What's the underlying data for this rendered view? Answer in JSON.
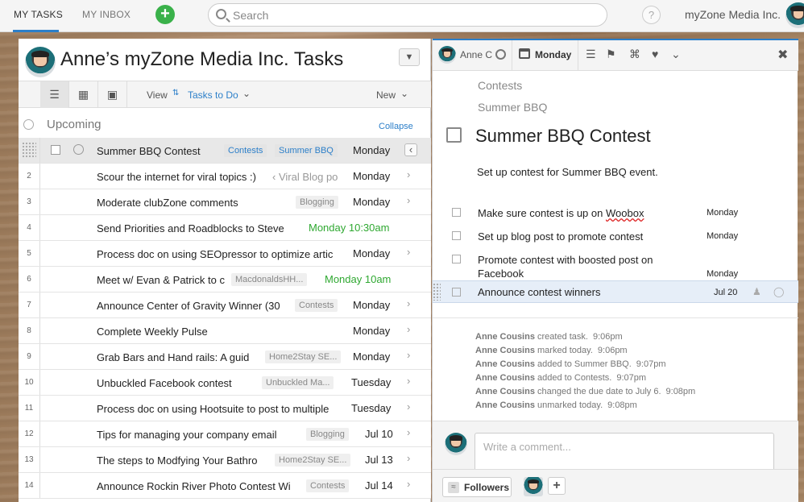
{
  "topbar": {
    "tab_my_tasks": "MY TASKS",
    "tab_my_inbox": "MY INBOX",
    "search_placeholder": "Search",
    "help": "?",
    "org_name": "myZone Media Inc."
  },
  "left": {
    "title": "Anne’s myZone Media Inc. Tasks",
    "view_label": "View",
    "view_value": "Tasks to Do",
    "new_label": "New",
    "section": "Upcoming",
    "collapse": "Collapse",
    "rows": [
      {
        "num": "",
        "name": "Summer BBQ Contest",
        "tags": [
          "Contests",
          "Summer BBQ"
        ],
        "due": "Monday",
        "selected": true
      },
      {
        "num": "2",
        "name": "Scour the internet for viral topics :)",
        "link": "‹ Viral Blog po",
        "due": "Monday"
      },
      {
        "num": "3",
        "name": "Moderate clubZone comments",
        "tags": [
          "Blogging"
        ],
        "due": "Monday"
      },
      {
        "num": "4",
        "name": "Send Priorities and Roadblocks to Steve",
        "due": "Monday 10:30am",
        "green": true
      },
      {
        "num": "5",
        "name": "Process doc on using SEOpressor to optimize artic",
        "due": "Monday"
      },
      {
        "num": "6",
        "name": "Meet w/ Evan & Patrick to c",
        "tags": [
          "MacdonaldsHH..."
        ],
        "due": "Monday 10am",
        "green": true
      },
      {
        "num": "7",
        "name": "Announce Center of Gravity Winner (30",
        "tags": [
          "Contests"
        ],
        "due": "Monday"
      },
      {
        "num": "8",
        "name": "Complete Weekly Pulse",
        "due": "Monday"
      },
      {
        "num": "9",
        "name": "Grab Bars and Hand rails: A guid",
        "tags": [
          "Home2Stay SE..."
        ],
        "due": "Monday"
      },
      {
        "num": "10",
        "name": "Unbuckled Facebook contest",
        "tags": [
          "Unbuckled Ma..."
        ],
        "due": "Tuesday"
      },
      {
        "num": "11",
        "name": "Process doc on using Hootsuite to post to multiple",
        "due": "Tuesday"
      },
      {
        "num": "12",
        "name": "Tips for managing your company email",
        "tags": [
          "Blogging"
        ],
        "due": "Jul 10"
      },
      {
        "num": "13",
        "name": "The steps to Modfying Your Bathro",
        "tags": [
          "Home2Stay SE..."
        ],
        "due": "Jul 13"
      },
      {
        "num": "14",
        "name": "Announce Rockin River Photo Contest Wi",
        "tags": [
          "Contests"
        ],
        "due": "Jul 14"
      }
    ]
  },
  "right": {
    "assignee": "Anne C",
    "due_date": "Monday",
    "breadcrumbs": [
      "Contests",
      "Summer BBQ"
    ],
    "task_title": "Summer BBQ Contest",
    "description": "Set up contest for Summer BBQ event.",
    "subtasks": [
      {
        "name_pre": "Make sure contest is up on ",
        "name_woobox": "Woobox",
        "due": "Monday"
      },
      {
        "name": "Set up blog post to promote contest",
        "due": "Monday"
      },
      {
        "name": "Promote contest with boosted post on Facebook",
        "due": "Monday"
      },
      {
        "name": "Announce contest winners",
        "due": "Jul 20"
      }
    ],
    "activity": [
      {
        "who": "Anne Cousins",
        "what": " created task.",
        "when": "9:06pm"
      },
      {
        "who": "Anne Cousins",
        "what": " marked today.",
        "when": "9:06pm"
      },
      {
        "who": "Anne Cousins",
        "what": " added to Summer BBQ.",
        "when": "9:07pm"
      },
      {
        "who": "Anne Cousins",
        "what": " added to Contests.",
        "when": "9:07pm"
      },
      {
        "who": "Anne Cousins",
        "what": " changed the due date to July 6.",
        "when": "9:08pm"
      },
      {
        "who": "Anne Cousins",
        "what": " unmarked today.",
        "when": "9:08pm"
      }
    ],
    "comment_placeholder": "Write a comment...",
    "followers_label": "Followers"
  },
  "colors": {
    "accent": "#2c7fc9",
    "green": "#2fa831",
    "add_button": "#3ab14a"
  }
}
